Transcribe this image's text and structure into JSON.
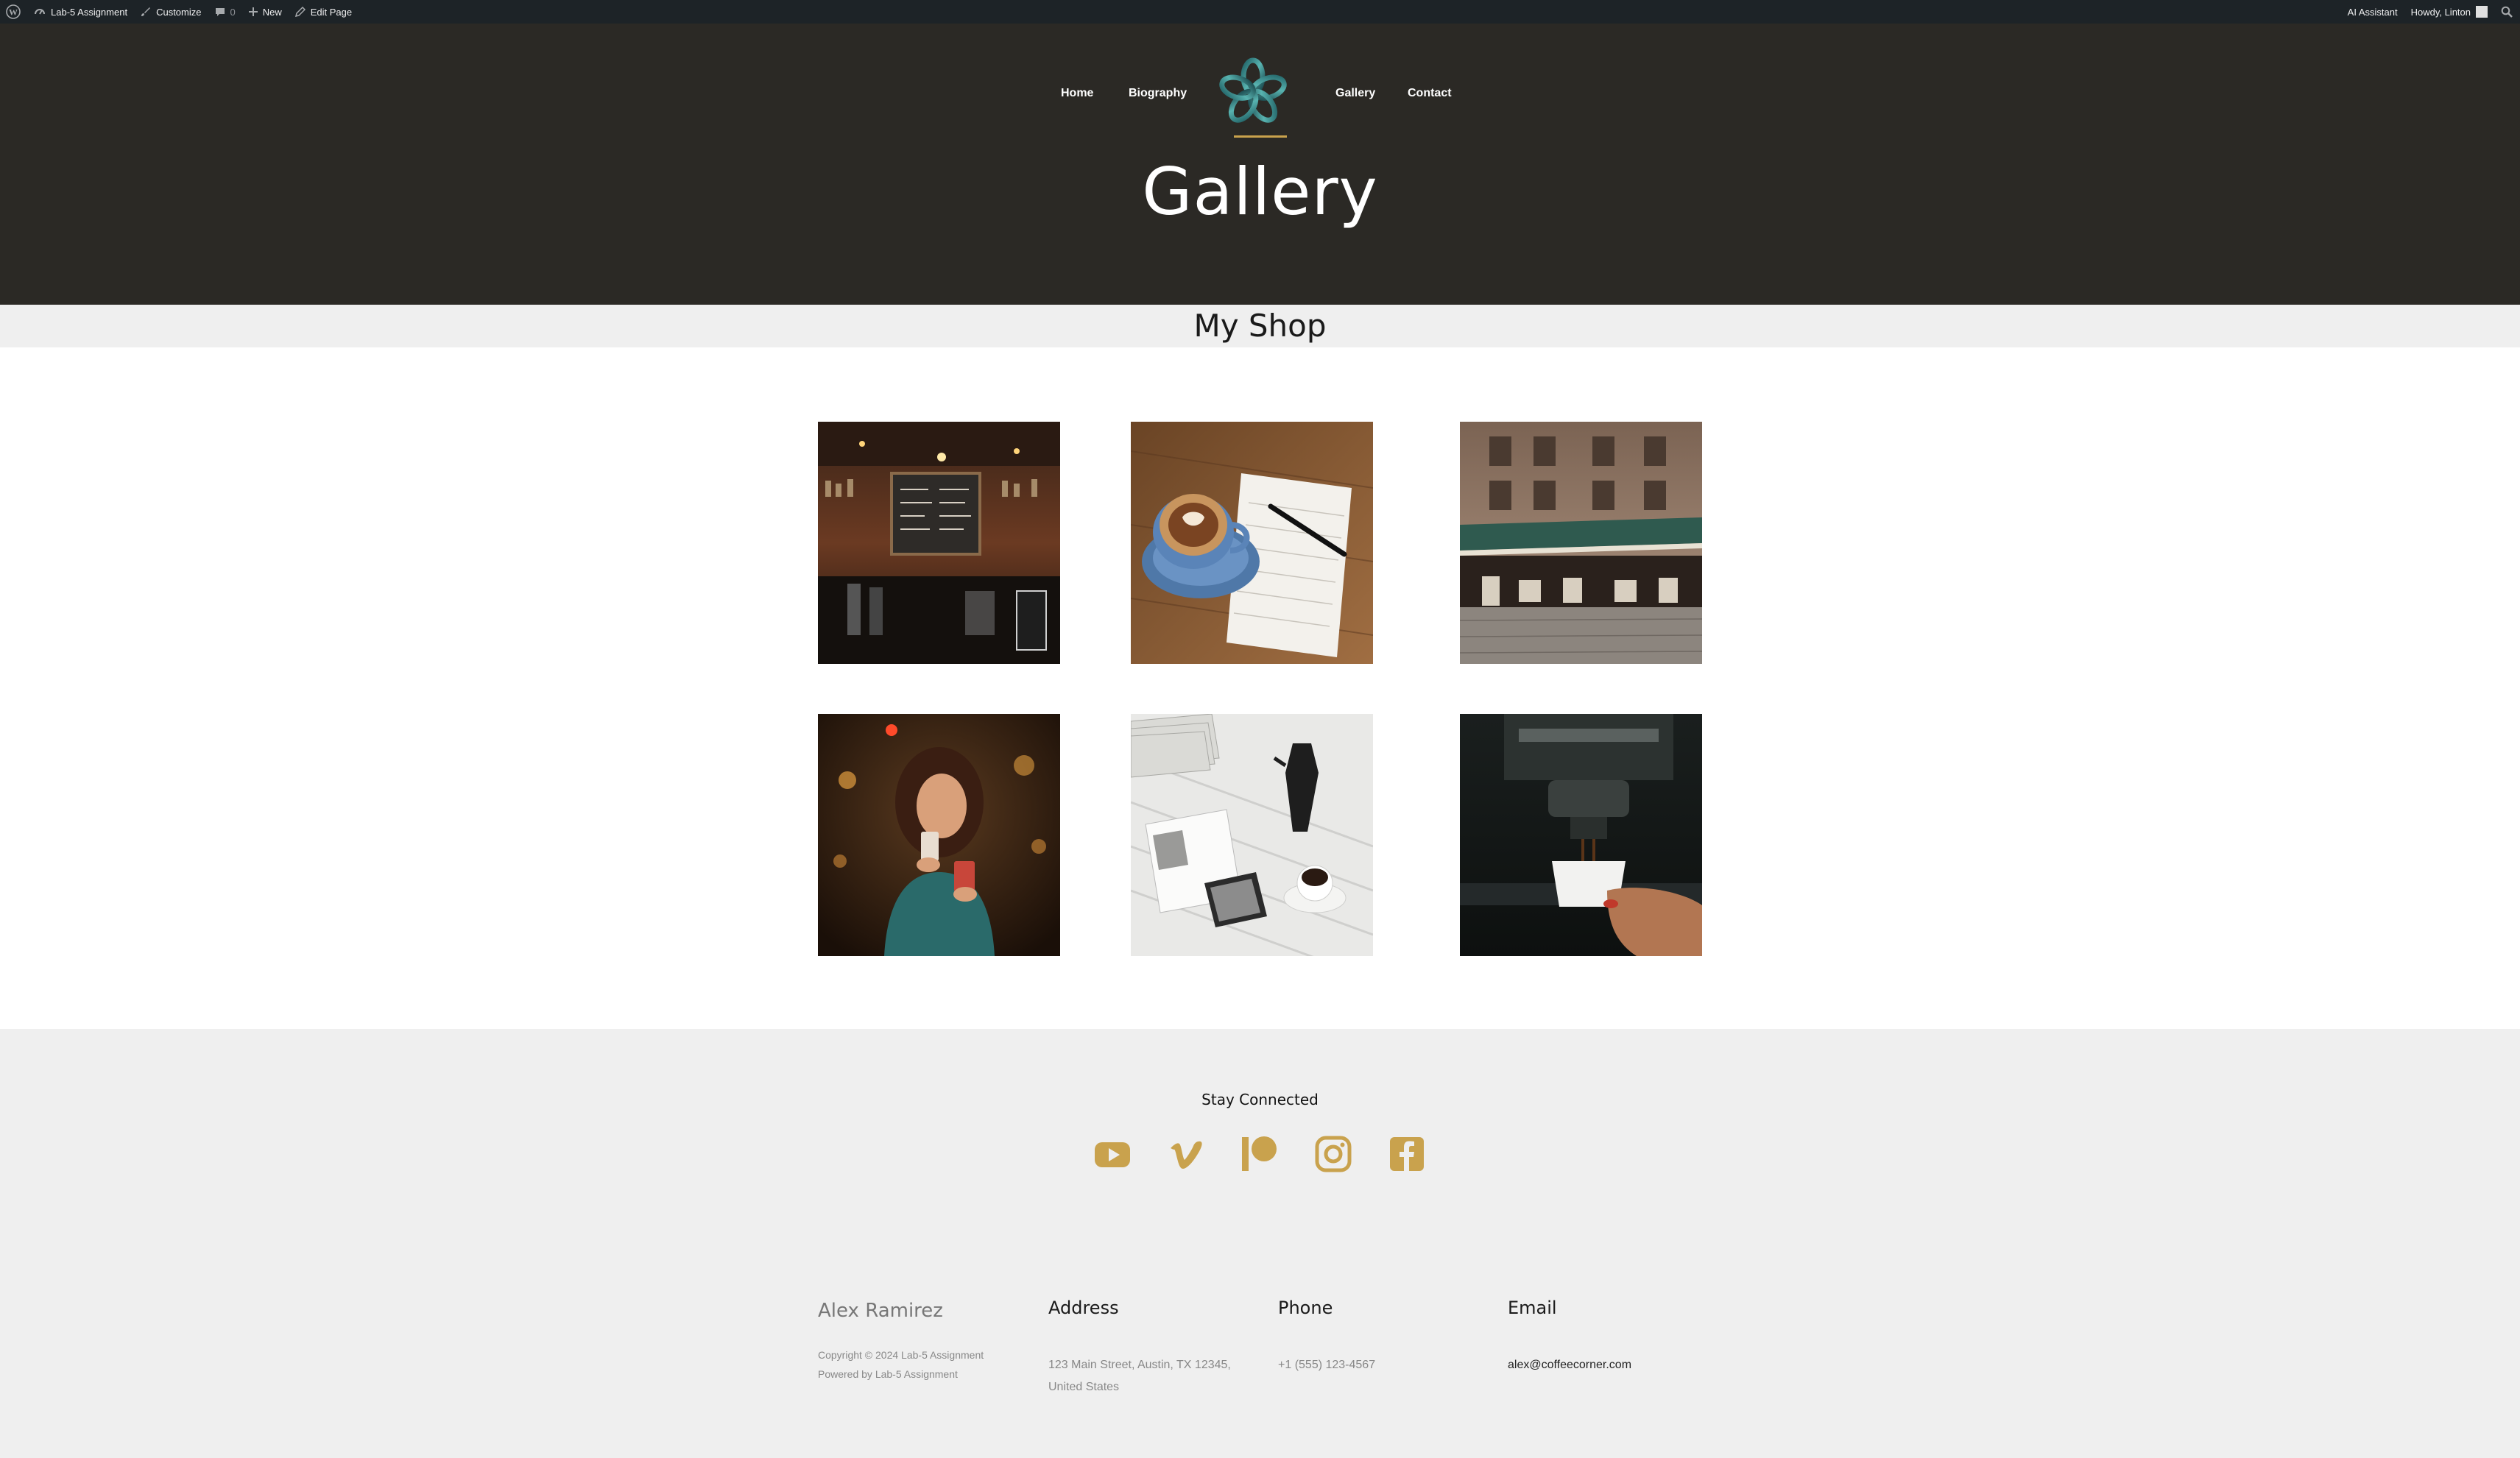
{
  "admin_bar": {
    "site_name": "Lab-5 Assignment",
    "customize": "Customize",
    "comments_count": "0",
    "new": "New",
    "edit_page": "Edit Page",
    "ai_assistant": "AI Assistant",
    "howdy": "Howdy, Linton",
    "icons": [
      "wordpress-icon",
      "dashboard-icon",
      "brush-icon",
      "comment-icon",
      "plus-icon",
      "pencil-icon",
      "search-icon"
    ]
  },
  "header": {
    "nav": [
      "Home",
      "Biography",
      "Gallery",
      "Contact"
    ],
    "title": "Gallery",
    "accent_color": "#c9a24d",
    "background": "#2b2925"
  },
  "shop": {
    "title": "My Shop"
  },
  "gallery": {
    "images": [
      "coffee shop bar with chalkboard menu",
      "latte in blue cup with notebook and pen",
      "outdoor street cafe with awnings",
      "woman drinking coffee reading phone",
      "white table with moka pot, tablet and magazines",
      "espresso pouring into white cup"
    ]
  },
  "footer": {
    "stay_connected": "Stay Connected",
    "social": [
      "youtube-icon",
      "vimeo-icon",
      "patreon-icon",
      "instagram-icon",
      "facebook-icon"
    ],
    "name": "Alex Ramirez",
    "copyright": "Copyright © 2024 Lab-5 Assignment",
    "powered": "Powered by Lab-5 Assignment",
    "address_label": "Address",
    "address_value": "123 Main Street, Austin, TX 12345, United States",
    "phone_label": "Phone",
    "phone_value": "+1 (555) 123-4567",
    "email_label": "Email",
    "email_value": "alex@coffeecorner.com",
    "icon_color": "#c9a24d"
  }
}
